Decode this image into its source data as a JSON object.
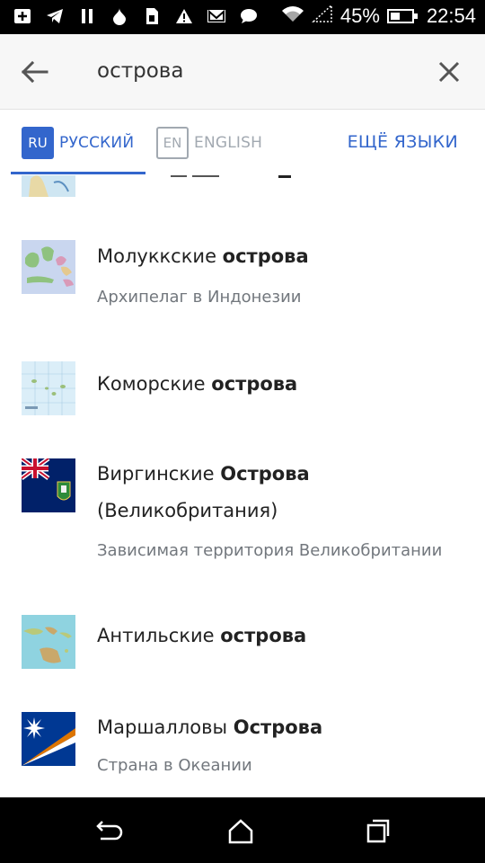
{
  "statusbar": {
    "battery": "45%",
    "time": "22:54",
    "battery_level": 0.45,
    "left_icons": [
      "add-box-icon",
      "telegram-icon",
      "pause-icon",
      "drop-icon",
      "sim-icon",
      "warning-icon",
      "gmail-icon",
      "chat-icon"
    ],
    "right_icons": [
      "wifi-icon",
      "signal-icon",
      "battery-icon"
    ]
  },
  "search": {
    "query": "острова"
  },
  "languages": {
    "ru_code": "RU",
    "ru_name": "РУССКИЙ",
    "en_code": "EN",
    "en_name": "ENGLISH",
    "more": "ЕЩЁ ЯЗЫКИ"
  },
  "results": [
    {
      "title_prefix": "Молуккские ",
      "title_bold": "острова",
      "title_suffix": "",
      "description": "Архипелаг в Индонезии"
    },
    {
      "title_prefix": "Коморские ",
      "title_bold": "острова",
      "title_suffix": "",
      "description": ""
    },
    {
      "title_prefix": "Виргинские ",
      "title_bold": "Острова",
      "title_suffix": "(Великобритания)",
      "description": "Зависимая территория Великобритании"
    },
    {
      "title_prefix": "Антильские ",
      "title_bold": "острова",
      "title_suffix": "",
      "description": ""
    },
    {
      "title_prefix": "Маршалловы ",
      "title_bold": "Острова",
      "title_suffix": "",
      "description": "Страна в Океании"
    }
  ],
  "colors": {
    "accent": "#3366cc",
    "muted": "#a2a9b1",
    "description": "#72777d"
  }
}
